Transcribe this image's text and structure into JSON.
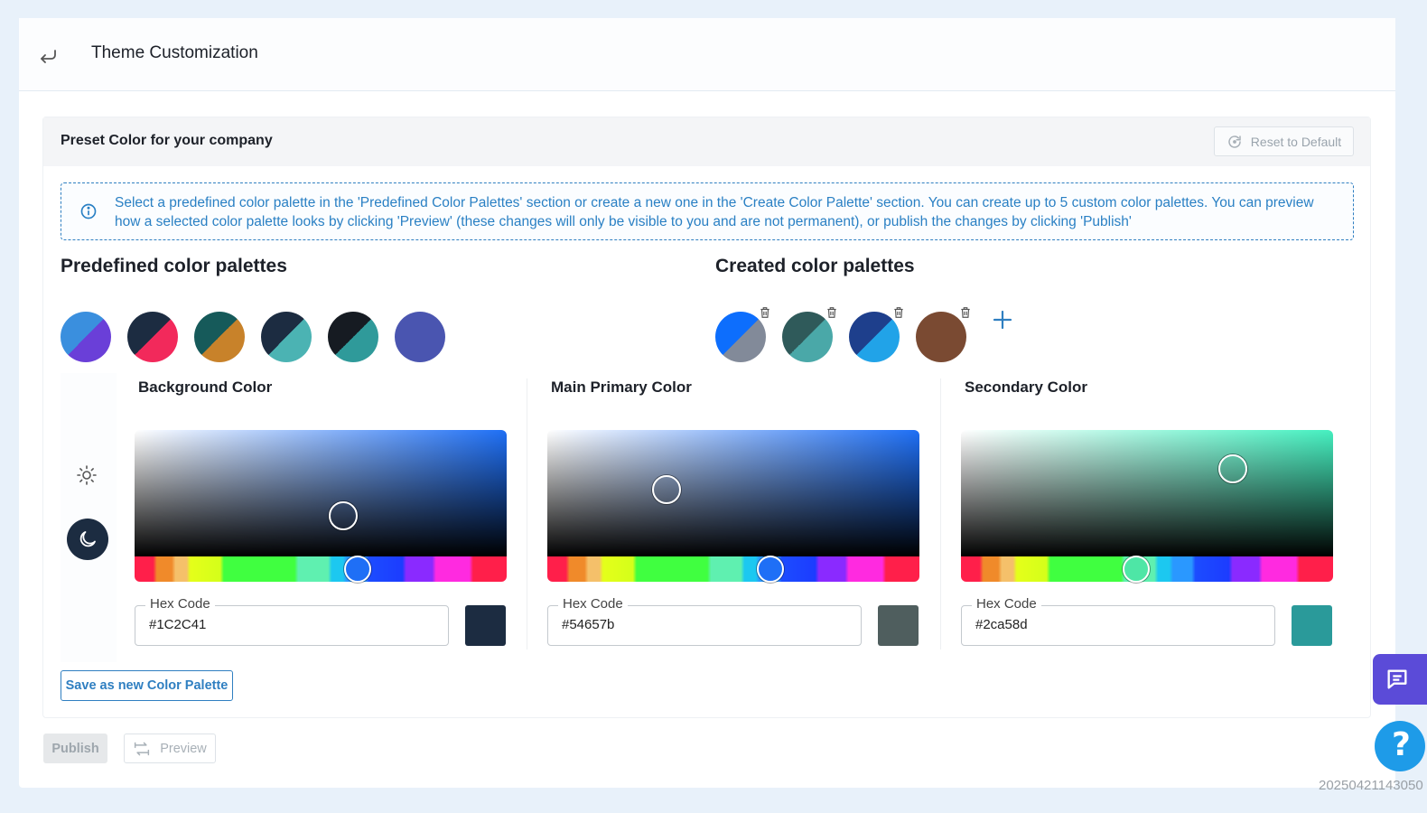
{
  "header": {
    "title": "Theme Customization"
  },
  "section": {
    "title": "Preset Color for your company",
    "reset_label": "Reset to Default",
    "info_text": "Select a predefined color palette in the 'Predefined Color Palettes' section or create a new one in the 'Create Color Palette' section. You can create up to 5 custom color palettes. You can preview how a selected color palette looks by clicking 'Preview' (these changes will only be visible to you and are not permanent), or publish the changes by clicking 'Publish'"
  },
  "predefined": {
    "title": "Predefined color palettes",
    "swatches": [
      {
        "c1": "#3a8fde",
        "c2": "#6a3fd8"
      },
      {
        "c1": "#1c2c41",
        "c2": "#f2295b"
      },
      {
        "c1": "#165a5a",
        "c2": "#c8822a"
      },
      {
        "c1": "#1c2c41",
        "c2": "#4bb3b3"
      },
      {
        "c1": "#161b22",
        "c2": "#2f9a9a"
      },
      {
        "c1": "#4a55b0",
        "c2": "#4a55b0"
      }
    ]
  },
  "created": {
    "title": "Created color palettes",
    "swatches": [
      {
        "c1": "#0d6efd",
        "c2": "#828a99"
      },
      {
        "c1": "#2f5a5a",
        "c2": "#4aa8a8"
      },
      {
        "c1": "#1e3f8c",
        "c2": "#21a3e8"
      },
      {
        "c1": "#7a4a32",
        "c2": "#7a4a32"
      }
    ]
  },
  "colors": [
    {
      "label": "Background Color",
      "hex_label": "Hex Code",
      "hex": "#1C2C41",
      "swatch": "#1c2c41",
      "hue": "#1e6ff5",
      "hue_handle": "#1f6ff6",
      "sv_pos": [
        0.56,
        0.68
      ],
      "hue_pos": 0.6
    },
    {
      "label": "Main Primary Color",
      "hex_label": "Hex Code",
      "hex": "#54657b",
      "swatch": "#4f5e5e",
      "hue": "#1e6ff5",
      "hue_handle": "#1f6ff6",
      "sv_pos": [
        0.32,
        0.47
      ],
      "hue_pos": 0.6
    },
    {
      "label": "Secondary Color",
      "hex_label": "Hex Code",
      "hex": "#2ca58d",
      "swatch": "#2a9a9a",
      "hue": "#45f0c0",
      "hue_handle": "#4ee6a6",
      "sv_pos": [
        0.73,
        0.31
      ],
      "hue_pos": 0.47
    }
  ],
  "save_label": "Save as new Color Palette",
  "footer": {
    "publish_label": "Publish",
    "preview_label": "Preview"
  },
  "timestamp": "20250421143050"
}
